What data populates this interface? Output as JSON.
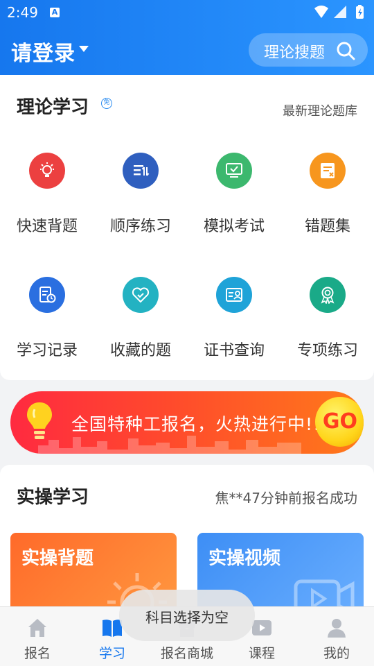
{
  "status_bar": {
    "time": "2:49",
    "notification_icon": "A"
  },
  "header": {
    "login_label": "请登录",
    "search_label": "理论搜题"
  },
  "theory": {
    "title": "理论学习",
    "badge": "免",
    "link": "最新理论题库",
    "items": [
      {
        "label": "快速背题",
        "icon": "lightbulb-icon",
        "color": "#ec4040"
      },
      {
        "label": "顺序练习",
        "icon": "sort-list-icon",
        "color": "#2f5fbf"
      },
      {
        "label": "模拟考试",
        "icon": "monitor-check-icon",
        "color": "#3cb86e"
      },
      {
        "label": "错题集",
        "icon": "wrong-doc-icon",
        "color": "#f7961e"
      },
      {
        "label": "学习记录",
        "icon": "record-clock-icon",
        "color": "#2a6fe0"
      },
      {
        "label": "收藏的题",
        "icon": "heart-check-icon",
        "color": "#23b2c2"
      },
      {
        "label": "证书查询",
        "icon": "certificate-icon",
        "color": "#1fa3d8"
      },
      {
        "label": "专项练习",
        "icon": "award-icon",
        "color": "#1aaa88"
      }
    ]
  },
  "banner": {
    "text": "全国特种工报名，火热进行中!!!",
    "go_label": "GO"
  },
  "practice": {
    "title": "实操学习",
    "notice": "焦**47分钟前报名成功",
    "tiles": [
      {
        "label": "实操背题"
      },
      {
        "label": "实操视频"
      }
    ]
  },
  "toast": {
    "text": "科目选择为空"
  },
  "bottom_nav": {
    "items": [
      {
        "label": "报名",
        "icon": "home-icon"
      },
      {
        "label": "学习",
        "icon": "book-icon"
      },
      {
        "label": "报名商城",
        "icon": "shop-icon"
      },
      {
        "label": "课程",
        "icon": "play-icon"
      },
      {
        "label": "我的",
        "icon": "user-icon"
      }
    ],
    "active_index": 1
  },
  "colors": {
    "brand_blue": "#1677ee",
    "banner_red": "#ff2a40",
    "go_yellow": "#ffd51a"
  }
}
